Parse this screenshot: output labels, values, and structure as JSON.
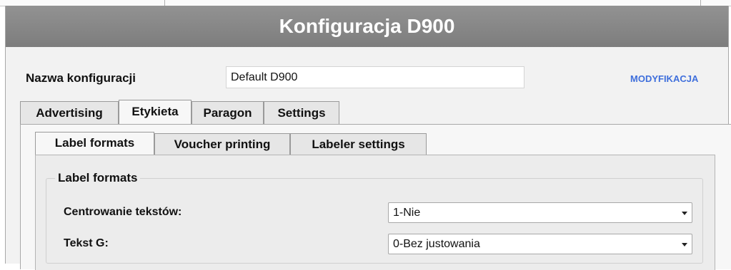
{
  "window": {
    "title": "Konfiguracja D900"
  },
  "config": {
    "name_label": "Nazwa konfiguracji",
    "name_value": "Default D900",
    "modify_label": "MODYFIKACJA"
  },
  "tabs": [
    {
      "label": "Advertising",
      "active": false
    },
    {
      "label": "Etykieta",
      "active": true
    },
    {
      "label": "Paragon",
      "active": false
    },
    {
      "label": "Settings",
      "active": false
    }
  ],
  "subtabs": [
    {
      "label": "Label formats",
      "active": true
    },
    {
      "label": "Voucher printing",
      "active": false
    },
    {
      "label": "Labeler settings",
      "active": false
    }
  ],
  "label_formats": {
    "legend": "Label formats",
    "fields": [
      {
        "label": "Centrowanie tekstów:",
        "value": "1-Nie"
      },
      {
        "label": "Tekst G:",
        "value": "0-Bez justowania"
      }
    ]
  },
  "colors": {
    "titlebar": "#888888",
    "link": "#3f6fdc",
    "panel": "#ececec"
  }
}
